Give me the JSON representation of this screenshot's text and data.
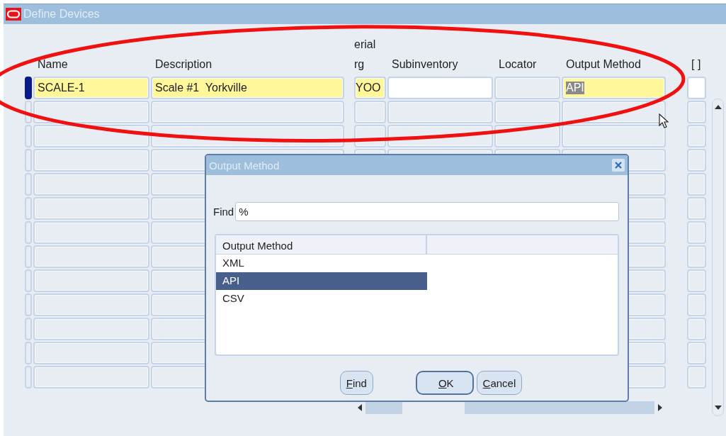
{
  "window": {
    "title": "Define Devices"
  },
  "table": {
    "group_header": "erial",
    "columns": [
      {
        "label": "Name",
        "required": true
      },
      {
        "label": "Description",
        "required": true
      },
      {
        "label": "rg",
        "required": true
      },
      {
        "label": "Subinventory",
        "required": false,
        "disabled": false
      },
      {
        "label": "Locator",
        "required": false,
        "disabled": true
      },
      {
        "label": "Output Method",
        "required": true
      },
      {
        "label": "[ ]",
        "required": false,
        "disabled": false
      }
    ],
    "rows": [
      {
        "current": true,
        "cells": [
          {
            "text": "SCALE-1"
          },
          {
            "text": "Scale #1  Yorkville"
          },
          {
            "text": "YOO"
          },
          {},
          {},
          {
            "text": "API",
            "highlighted": true
          },
          {}
        ]
      },
      {
        "current": false
      },
      {
        "current": false
      },
      {
        "current": false
      },
      {
        "current": false
      },
      {
        "current": false
      },
      {
        "current": false
      },
      {
        "current": false
      },
      {
        "current": false
      },
      {
        "current": false
      },
      {
        "current": false
      },
      {
        "current": false
      },
      {
        "current": false
      }
    ]
  },
  "dialog": {
    "title": "Output Method",
    "find": {
      "label": "Find",
      "value": "%"
    },
    "list": {
      "columns": [
        "Output Method"
      ],
      "items": [
        {
          "label": "XML",
          "selected": false
        },
        {
          "label": "API",
          "selected": true
        },
        {
          "label": "CSV",
          "selected": false
        }
      ]
    },
    "buttons": [
      {
        "label": "Find",
        "default": false,
        "mnemonic_underlined": true
      },
      {
        "label": "OK",
        "default": true,
        "mnemonic_underlined": true
      },
      {
        "label": "Cancel",
        "default": false,
        "mnemonic_underlined": true
      }
    ]
  }
}
